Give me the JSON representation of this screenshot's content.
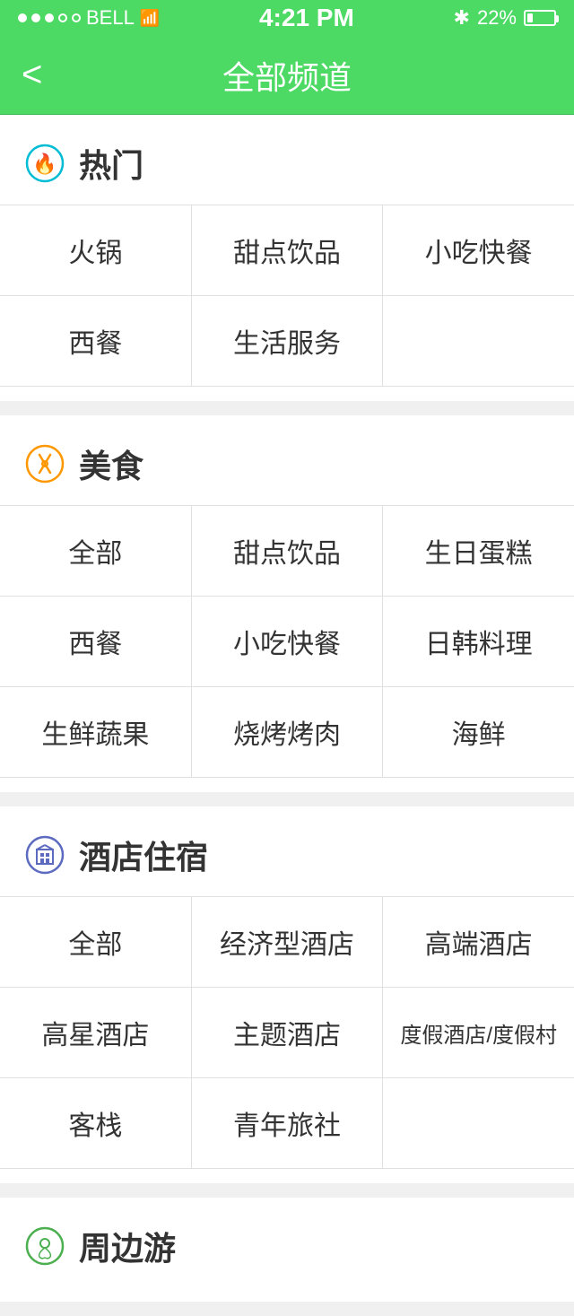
{
  "statusBar": {
    "carrier": "BELL",
    "time": "4:21 PM",
    "battery": "22%",
    "bluetooth": "⚡"
  },
  "navBar": {
    "backLabel": "<",
    "title": "全部频道"
  },
  "sections": [
    {
      "id": "hot",
      "iconType": "hot",
      "title": "热门",
      "items": [
        [
          "火锅",
          "甜点饮品",
          "小吃快餐"
        ],
        [
          "西餐",
          "生活服务",
          ""
        ]
      ]
    },
    {
      "id": "food",
      "iconType": "food",
      "title": "美食",
      "items": [
        [
          "全部",
          "甜点饮品",
          "生日蛋糕"
        ],
        [
          "西餐",
          "小吃快餐",
          "日韩料理"
        ],
        [
          "生鲜蔬果",
          "烧烤烤肉",
          "海鲜"
        ]
      ]
    },
    {
      "id": "hotel",
      "iconType": "hotel",
      "title": "酒店住宿",
      "items": [
        [
          "全部",
          "经济型酒店",
          "高端酒店"
        ],
        [
          "高星酒店",
          "主题酒店",
          "度假酒店/度假村"
        ],
        [
          "客栈",
          "青年旅社",
          ""
        ]
      ]
    },
    {
      "id": "around",
      "iconType": "around",
      "title": "周边游",
      "items": []
    }
  ]
}
